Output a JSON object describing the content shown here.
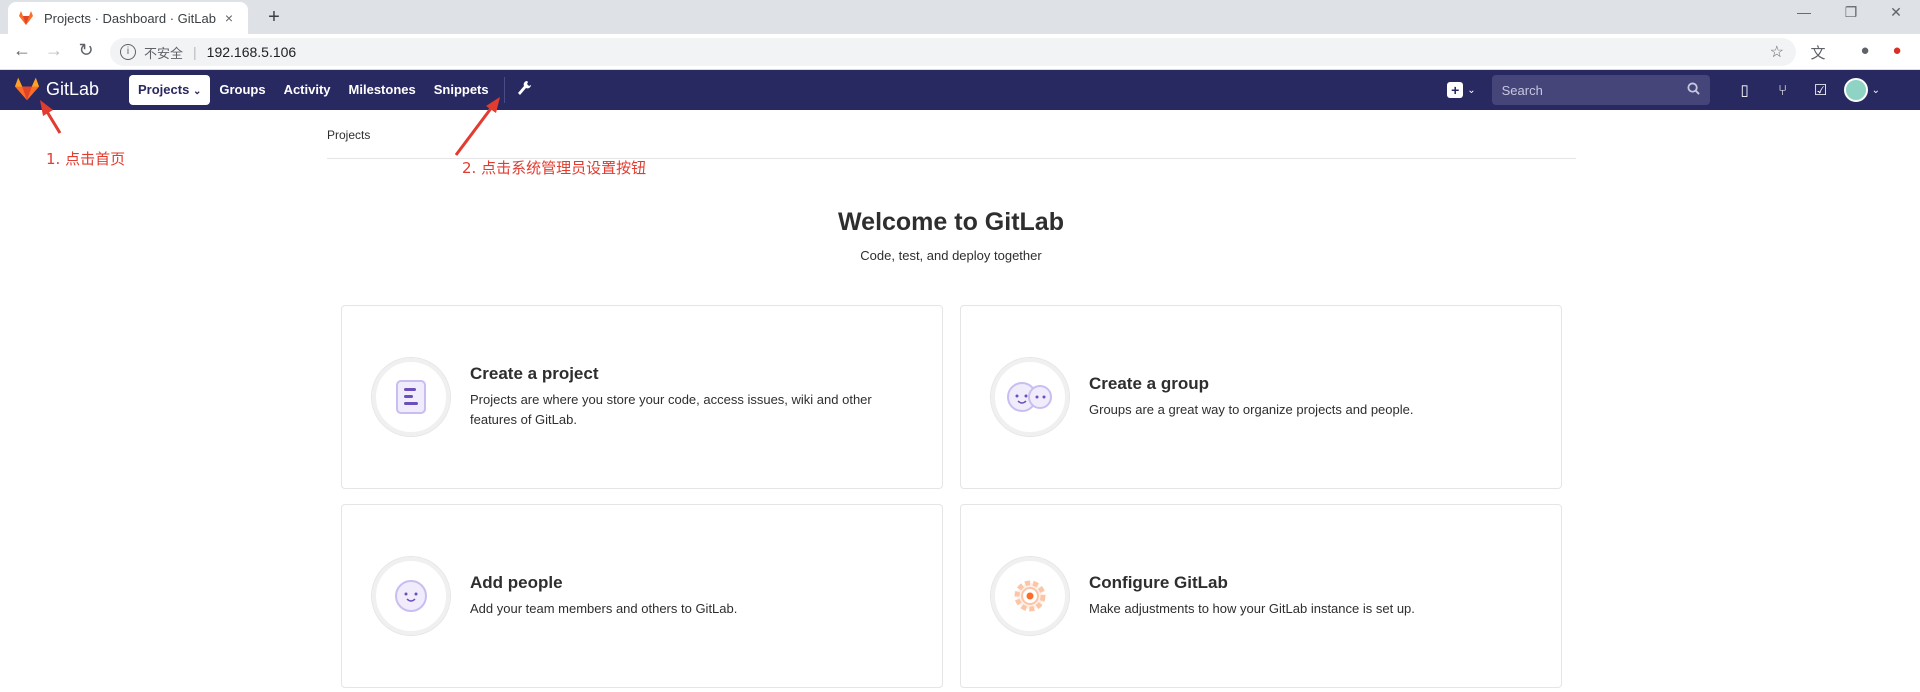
{
  "browser": {
    "tab_title": "Projects · Dashboard · GitLab",
    "tab_close": "×",
    "new_tab": "+",
    "security_label": "不安全",
    "url": "192.168.5.106",
    "win_min": "—",
    "win_max": "❐",
    "win_close": "✕"
  },
  "gitlab_nav": {
    "logo_text": "GitLab",
    "links": [
      "Projects",
      "Groups",
      "Activity",
      "Milestones",
      "Snippets"
    ],
    "search_placeholder": "Search"
  },
  "breadcrumb": "Projects",
  "annotations": {
    "step1": "1.  点击首页",
    "step2": "2.  点击系统管理员设置按钮"
  },
  "welcome": {
    "title": "Welcome to GitLab",
    "subtitle": "Code, test, and deploy together"
  },
  "cards": [
    {
      "title": "Create a project",
      "desc": "Projects are where you store your code, access issues, wiki and other features of GitLab."
    },
    {
      "title": "Create a group",
      "desc": "Groups are a great way to organize projects and people."
    },
    {
      "title": "Add people",
      "desc": "Add your team members and others to GitLab."
    },
    {
      "title": "Configure GitLab",
      "desc": "Make adjustments to how your GitLab instance is set up."
    }
  ],
  "colors": {
    "navbar": "#292961",
    "annotation": "#e23b2f",
    "logo_orange": "#fc6d26"
  }
}
